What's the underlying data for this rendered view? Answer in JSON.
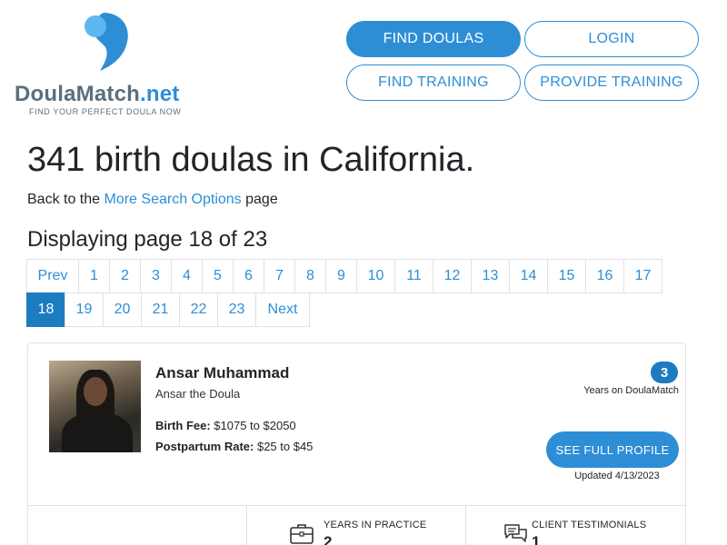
{
  "logo": {
    "brand_main": "DoulaMatch",
    "brand_tld": ".net",
    "tagline": "FIND YOUR PERFECT DOULA NOW",
    "colors": {
      "blue_dark": "#2d8ed6",
      "blue_light": "#5bb8f0",
      "gray": "#5a6f7e"
    }
  },
  "nav": {
    "find_doulas": "FIND DOULAS",
    "login": "LOGIN",
    "find_training": "FIND TRAINING",
    "provide_training": "PROVIDE TRAINING"
  },
  "page": {
    "title": "341 birth doulas in California.",
    "back_prefix": "Back to the ",
    "back_link": "More Search Options",
    "back_suffix": " page",
    "display_title": "Displaying page 18 of 23"
  },
  "pagination": {
    "prev": "Prev",
    "next": "Next",
    "current": "18",
    "row1": [
      "1",
      "2",
      "3",
      "4",
      "5",
      "6",
      "7",
      "8",
      "9",
      "10",
      "11",
      "12",
      "13",
      "14",
      "15",
      "16",
      "17"
    ],
    "row2": [
      "18",
      "19",
      "20",
      "21",
      "22",
      "23"
    ]
  },
  "card": {
    "name": "Ansar Muhammad",
    "business": "Ansar the Doula",
    "fee_label": "Birth Fee:",
    "fee_value": " $1075 to $2050",
    "rate_label": "Postpartum Rate:",
    "rate_value": " $25 to $45",
    "years_badge": "3",
    "years_label": "Years on DoulaMatch",
    "profile_button": "SEE FULL PROFILE",
    "updated": "Updated 4/13/2023",
    "stats": [
      {
        "label": "",
        "value": "",
        "icon": "none"
      },
      {
        "label": "YEARS IN PRACTICE",
        "value": "2",
        "icon": "briefcase-icon"
      },
      {
        "label": "CLIENT TESTIMONIALS",
        "value": "1",
        "icon": "chat-icon"
      }
    ]
  }
}
